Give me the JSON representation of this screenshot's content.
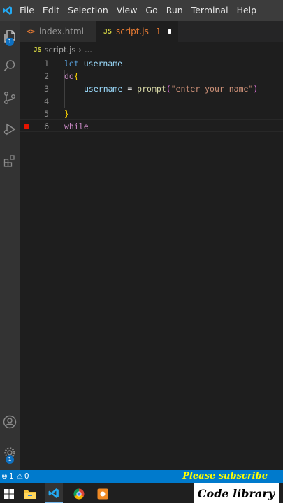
{
  "menu": {
    "items": [
      "File",
      "Edit",
      "Selection",
      "View",
      "Go",
      "Run",
      "Terminal",
      "Help"
    ]
  },
  "activity": {
    "explorer_icon": "files-icon",
    "explorer_badge": "1",
    "search_icon": "search-icon",
    "scm_icon": "source-control-icon",
    "debug_icon": "run-debug-icon",
    "extensions_icon": "extensions-icon",
    "account_icon": "account-icon",
    "settings_icon": "gear-icon",
    "settings_badge": "1"
  },
  "tabs": [
    {
      "icon": "<>",
      "label": "index.html"
    },
    {
      "icon": "JS",
      "label": "script.js",
      "problems": "1"
    }
  ],
  "breadcrumb": {
    "icon": "JS",
    "file": "script.js",
    "more": "..."
  },
  "editor": {
    "lines": [
      {
        "number": "1"
      },
      {
        "number": "2"
      },
      {
        "number": "3"
      },
      {
        "number": "4"
      },
      {
        "number": "5"
      },
      {
        "number": "6"
      }
    ],
    "tokens": {
      "let": "let",
      "username_decl": "username",
      "do": "do",
      "open_brace": "{",
      "username_assign": "username",
      "equals": " = ",
      "prompt": "prompt",
      "open_paren": "(",
      "prompt_string": "\"enter your name\"",
      "close_paren": ")",
      "close_brace": "}",
      "while": "while"
    }
  },
  "status": {
    "errors": "1",
    "warnings": "0",
    "overlay": "Please subscribe"
  },
  "taskbar": {
    "channel": "Code library"
  },
  "colors": {
    "accent": "#007acc",
    "breakpoint": "#e51400",
    "overlay_text": "#ffff00"
  }
}
